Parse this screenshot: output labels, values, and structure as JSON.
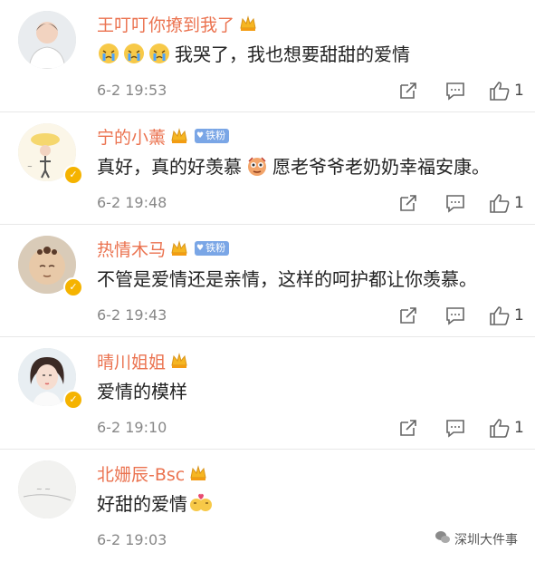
{
  "comments": [
    {
      "username": "王叮叮你撩到我了",
      "text": "我哭了，我也想要甜甜的爱情",
      "time": "6-2 19:53",
      "likes": "1",
      "fan_badge": "",
      "verified": false,
      "leading_emoji": [
        "crying-emoji",
        "crying-emoji",
        "crying-emoji"
      ],
      "inline_emoji": ""
    },
    {
      "username": "宁的小薰",
      "text_before": "真好，真的好羡慕",
      "text_after": "愿老爷爷老奶奶幸福安康。",
      "time": "6-2 19:48",
      "likes": "1",
      "fan_badge": "铁粉",
      "verified": true,
      "inline_emoji": "envy-emoji"
    },
    {
      "username": "热情木马",
      "text": "不管是爱情还是亲情，这样的呵护都让你羡慕。",
      "time": "6-2 19:43",
      "likes": "1",
      "fan_badge": "铁粉",
      "verified": true
    },
    {
      "username": "晴川姐姐",
      "text": "爱情的模样",
      "time": "6-2 19:10",
      "likes": "1",
      "fan_badge": "",
      "verified": true
    },
    {
      "username": "北姗辰-Bsc",
      "text": "好甜的爱情",
      "time": "6-2 19:03",
      "likes": "",
      "fan_badge": "",
      "verified": false,
      "inline_emoji": "kissing-couple-emoji"
    }
  ],
  "watermark": {
    "text": "深圳大件事"
  },
  "colors": {
    "username": "#eb7350",
    "text": "#222222",
    "meta": "#888888",
    "badge": "#7aa6e6",
    "verified": "#f5b300"
  }
}
